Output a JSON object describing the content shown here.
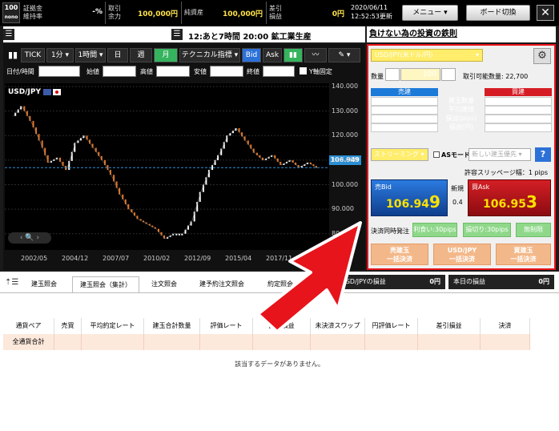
{
  "topbar": {
    "logo_top": "100",
    "logo_bottom": "nono",
    "margin_rate_label": "証拠金\n維持率",
    "margin_rate_value": "-%",
    "available_label": "取引\n余力",
    "available_value": "100,000円",
    "net_assets_label": "純資産",
    "net_assets_value": "100,000円",
    "diff_pnl_label": "差引\n損益",
    "diff_pnl_value": "0円",
    "date": "2020/06/11",
    "time": "12:52:53更新",
    "menu_label": "メニュー",
    "board_switch_label": "ボード切換",
    "close_label": "✕"
  },
  "ticker": {
    "text": "12:あと7時間 20:00 鉱工業生産",
    "link": "負けない為の投資の鉄則"
  },
  "chart_toolbar": {
    "tick": "TICK",
    "interval1": "1分",
    "interval2": "1時間",
    "day": "日",
    "week": "週",
    "month": "月",
    "indicator": "テクニカル指標",
    "bid": "Bid",
    "ask": "Ask"
  },
  "ohlc_labels": {
    "datetime": "日付/時間",
    "open": "始値",
    "high": "高値",
    "low": "安値",
    "close": "終値",
    "yfix": "Y軸固定"
  },
  "chart_data": {
    "type": "line",
    "title": "USD/JPY",
    "x": [
      "2002/05",
      "2004/12",
      "2007/07",
      "2010/02",
      "2012/09",
      "2015/04",
      "2017/11"
    ],
    "ylim": [
      76,
      140
    ],
    "yticks": [
      140,
      130,
      120,
      110,
      100,
      90,
      80
    ],
    "current_price": "106.949",
    "series": [
      {
        "values": [
          128,
          132,
          126,
          118,
          109,
          111,
          106,
          117,
          120,
          115,
          110,
          104,
          96,
          90,
          86,
          84,
          82,
          78,
          80,
          80,
          85,
          97,
          106,
          112,
          120,
          123,
          118,
          113,
          110,
          112,
          108,
          110,
          107,
          109,
          106.9
        ]
      }
    ]
  },
  "order": {
    "pair": "USD/JPY(米ドル/円)",
    "qty_label": "数量",
    "qty_value": "100",
    "tradable_label": "取引可能数量:",
    "tradable_value": "22,700",
    "sell_header": "売建",
    "buy_header": "買建",
    "rows": [
      {
        "sell": "0",
        "label": "建玉数量",
        "buy": "0"
      },
      {
        "sell": "0.000",
        "label": "平均建値",
        "buy": "0.000"
      },
      {
        "sell": "0.000",
        "label": "損益(pips)",
        "buy": "0.000"
      },
      {
        "sell": "0",
        "label": "損益(円)",
        "buy": "0"
      }
    ],
    "streaming": "ストリーミング",
    "as_mode_label": "ASモード:",
    "as_mode_placeholder": "新しい建玉優先",
    "help": "?",
    "slippage": "許容スリッページ幅：1 pips",
    "sell_bid_label": "売Bid",
    "sell_price_main": "106.94",
    "sell_price_last": "9",
    "spread_label": "新規",
    "spread_value": "0.4",
    "buy_ask_label": "買Ask",
    "buy_price_main": "106.95",
    "buy_price_last": "3",
    "settle_label": "決済同時発注",
    "limit_label": "利食い:30pips",
    "stop_label": "損切り:30pips",
    "unlimited_label": "無制限",
    "settle_sell": "売建玉\n一括決済",
    "settle_pair": "USD/JPY\n一括決済",
    "settle_buy": "買建玉\n一括決済"
  },
  "bottom": {
    "tabs": [
      "建玉照会",
      "建玉照会（集計）",
      "注文照会",
      "建予約注文照会",
      "約定照会"
    ],
    "usd_pnl_label": "USD/JPYの損益",
    "usd_pnl_value": "0円",
    "today_pnl_label": "本日の損益",
    "today_pnl_value": "0円",
    "columns": [
      "通貨ペア",
      "売買",
      "平均約定レート",
      "建玉合計数量",
      "評価レート",
      "評価損益",
      "未決済スワップ",
      "円評価レート",
      "差引損益",
      "決済"
    ],
    "row_label": "全通貨合計",
    "empty_message": "該当するデータがありません。"
  }
}
